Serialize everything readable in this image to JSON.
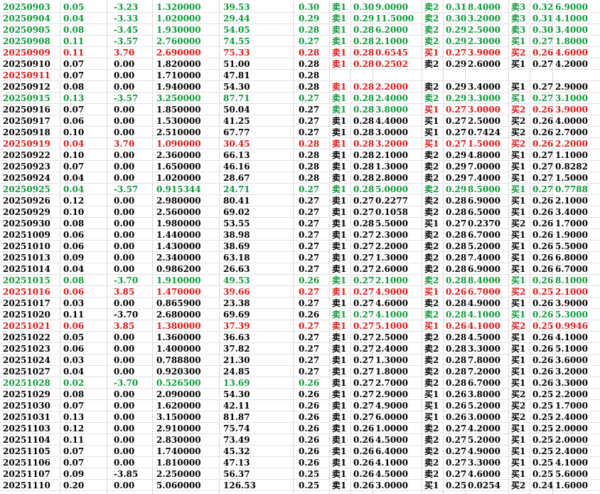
{
  "colors": {
    "up": "#e31414",
    "down": "#0a9a38",
    "flat": "#000000"
  },
  "rows": [
    {
      "date": "20250903",
      "a": "0.05",
      "b": "-3.23",
      "c": "1.320000",
      "d": "39.53",
      "e": "0.30",
      "t1": "卖1",
      "p1": "0.30",
      "v1": "9.0000",
      "t2": "卖2",
      "p2": "0.31",
      "v2": "8.4000",
      "t3": "卖3",
      "p3": "0.32",
      "v3": "6.9000",
      "color": "green",
      "c1": "green",
      "c2": "green",
      "c3": "green"
    },
    {
      "date": "20250904",
      "a": "0.04",
      "b": "-3.33",
      "c": "1.020000",
      "d": "29.44",
      "e": "0.29",
      "t1": "卖1",
      "p1": "0.29",
      "v1": "11.5000",
      "t2": "卖2",
      "p2": "0.30",
      "v2": "3.2000",
      "t3": "卖3",
      "p3": "0.31",
      "v3": "4.1000",
      "color": "green",
      "c1": "green",
      "c2": "green",
      "c3": "green"
    },
    {
      "date": "20250905",
      "a": "0.08",
      "b": "-3.45",
      "c": "1.930000",
      "d": "54.05",
      "e": "0.28",
      "t1": "卖1",
      "p1": "0.28",
      "v1": "6.2000",
      "t2": "卖2",
      "p2": "0.29",
      "v2": "2.5000",
      "t3": "卖3",
      "p3": "0.30",
      "v3": "3.4000",
      "color": "green",
      "c1": "green",
      "c2": "green",
      "c3": "green"
    },
    {
      "date": "20250908",
      "a": "0.11",
      "b": "-3.57",
      "c": "2.760000",
      "d": "74.55",
      "e": "0.27",
      "t1": "卖1",
      "p1": "0.28",
      "v1": "2.1000",
      "t2": "卖2",
      "p2": "0.29",
      "v2": "2.3000",
      "t3": "买1",
      "p3": "0.27",
      "v3": "1.8000",
      "color": "green",
      "c1": "green",
      "c2": "green",
      "c3": "green"
    },
    {
      "date": "20250909",
      "a": "0.11",
      "b": "3.70",
      "c": "2.690000",
      "d": "75.33",
      "e": "0.28",
      "t1": "卖1",
      "p1": "0.28",
      "v1": "0.6545",
      "t2": "买1",
      "p2": "0.27",
      "v2": "3.9000",
      "t3": "买2",
      "p3": "0.26",
      "v3": "4.6000",
      "color": "red",
      "c1": "red",
      "c2": "red",
      "c3": "red"
    },
    {
      "date": "20250910",
      "a": "0.07",
      "b": "0.00",
      "c": "1.820000",
      "d": "51.00",
      "e": "0.28",
      "t1": "卖1",
      "p1": "0.28",
      "v1": "0.2502",
      "t2": "卖2",
      "p2": "0.29",
      "v2": "2.6000",
      "t3": "买1",
      "p3": "0.27",
      "v3": "4.2000",
      "color": "black",
      "c1": "red",
      "c2": "black",
      "c3": "black"
    },
    {
      "date": "20250911",
      "a": "0.07",
      "b": "0.00",
      "c": "1.710000",
      "d": "47.81",
      "e": "0.28",
      "t1": "",
      "p1": "",
      "v1": "",
      "t2": "",
      "p2": "",
      "v2": "",
      "t3": "",
      "p3": "",
      "v3": "",
      "color": "black",
      "datecolor": "red",
      "c1": "black",
      "c2": "black",
      "c3": "black"
    },
    {
      "date": "20250912",
      "a": "0.08",
      "b": "0.00",
      "c": "1.940000",
      "d": "54.30",
      "e": "0.28",
      "t1": "卖1",
      "p1": "0.28",
      "v1": "2.2000",
      "t2": "卖2",
      "p2": "0.29",
      "v2": "3.4000",
      "t3": "买1",
      "p3": "0.27",
      "v3": "2.9000",
      "color": "black",
      "c1": "red",
      "c2": "black",
      "c3": "black"
    },
    {
      "date": "20250915",
      "a": "0.13",
      "b": "-3.57",
      "c": "3.250000",
      "d": "87.71",
      "e": "0.27",
      "t1": "卖1",
      "p1": "0.28",
      "v1": "2.4000",
      "t2": "卖2",
      "p2": "0.29",
      "v2": "3.3000",
      "t3": "买1",
      "p3": "0.27",
      "v3": "3.1000",
      "color": "green",
      "c1": "green",
      "c2": "green",
      "c3": "green"
    },
    {
      "date": "20250916",
      "a": "0.07",
      "b": "0.00",
      "c": "1.850000",
      "d": "50.04",
      "e": "0.27",
      "t1": "卖1",
      "p1": "0.28",
      "v1": "3.8000",
      "t2": "买1",
      "p2": "0.27",
      "v2": "3.0000",
      "t3": "买2",
      "p3": "0.26",
      "v3": "3.9000",
      "color": "black",
      "c1": "green",
      "c2": "red",
      "c3": "red"
    },
    {
      "date": "20250917",
      "a": "0.06",
      "b": "0.00",
      "c": "1.530000",
      "d": "41.25",
      "e": "0.27",
      "t1": "卖1",
      "p1": "0.28",
      "v1": "4.4000",
      "t2": "买1",
      "p2": "0.27",
      "v2": "2.5000",
      "t3": "买2",
      "p3": "0.26",
      "v3": "4.0000",
      "color": "black",
      "c1": "black",
      "c2": "black",
      "c3": "black"
    },
    {
      "date": "20250918",
      "a": "0.10",
      "b": "0.00",
      "c": "2.510000",
      "d": "67.77",
      "e": "0.27",
      "t1": "卖1",
      "p1": "0.28",
      "v1": "3.0000",
      "t2": "买1",
      "p2": "0.27",
      "v2": "0.7424",
      "t3": "买2",
      "p3": "0.26",
      "v3": "2.7000",
      "color": "black",
      "c1": "black",
      "c2": "black",
      "c3": "black"
    },
    {
      "date": "20250919",
      "a": "0.04",
      "b": "3.70",
      "c": "1.090000",
      "d": "30.45",
      "e": "0.28",
      "t1": "卖1",
      "p1": "0.28",
      "v1": "3.2000",
      "t2": "买1",
      "p2": "0.27",
      "v2": "1.5000",
      "t3": "买2",
      "p3": "0.26",
      "v3": "2.2000",
      "color": "red",
      "c1": "red",
      "c2": "red",
      "c3": "red"
    },
    {
      "date": "20250922",
      "a": "0.10",
      "b": "0.00",
      "c": "2.360000",
      "d": "66.13",
      "e": "0.28",
      "t1": "卖1",
      "p1": "0.28",
      "v1": "2.1000",
      "t2": "卖2",
      "p2": "0.29",
      "v2": "4.8000",
      "t3": "买1",
      "p3": "0.27",
      "v3": "1.1000",
      "color": "black",
      "c1": "black",
      "c2": "black",
      "c3": "black"
    },
    {
      "date": "20250923",
      "a": "0.07",
      "b": "0.00",
      "c": "1.650000",
      "d": "46.16",
      "e": "0.28",
      "t1": "卖1",
      "p1": "0.28",
      "v1": "1.3000",
      "t2": "卖2",
      "p2": "0.29",
      "v2": "7.0000",
      "t3": "买1",
      "p3": "0.27",
      "v3": "0.8282",
      "color": "black",
      "c1": "black",
      "c2": "black",
      "c3": "black"
    },
    {
      "date": "20250924",
      "a": "0.04",
      "b": "0.00",
      "c": "1.020000",
      "d": "28.67",
      "e": "0.28",
      "t1": "卖1",
      "p1": "0.28",
      "v1": "2.8000",
      "t2": "卖2",
      "p2": "0.29",
      "v2": "7.4000",
      "t3": "买1",
      "p3": "0.27",
      "v3": "1.5000",
      "color": "black",
      "c1": "black",
      "c2": "black",
      "c3": "black"
    },
    {
      "date": "20250925",
      "a": "0.04",
      "b": "-3.57",
      "c": "0.915344",
      "d": "24.71",
      "e": "0.27",
      "t1": "卖1",
      "p1": "0.28",
      "v1": "5.0000",
      "t2": "卖2",
      "p2": "0.29",
      "v2": "8.5000",
      "t3": "买1",
      "p3": "0.27",
      "v3": "0.7788",
      "color": "green",
      "c1": "green",
      "c2": "green",
      "c3": "green"
    },
    {
      "date": "20250926",
      "a": "0.12",
      "b": "0.00",
      "c": "2.980000",
      "d": "80.41",
      "e": "0.27",
      "t1": "卖1",
      "p1": "0.27",
      "v1": "0.2277",
      "t2": "卖2",
      "p2": "0.28",
      "v2": "6.9000",
      "t3": "买1",
      "p3": "0.26",
      "v3": "2.1000",
      "color": "black",
      "c1": "black",
      "c2": "black",
      "c3": "black"
    },
    {
      "date": "20250929",
      "a": "0.10",
      "b": "0.00",
      "c": "2.560000",
      "d": "69.02",
      "e": "0.27",
      "t1": "卖1",
      "p1": "0.27",
      "v1": "0.1058",
      "t2": "卖2",
      "p2": "0.28",
      "v2": "6.5000",
      "t3": "买1",
      "p3": "0.26",
      "v3": "3.4000",
      "color": "black",
      "c1": "black",
      "c2": "black",
      "c3": "black"
    },
    {
      "date": "20250930",
      "a": "0.08",
      "b": "0.00",
      "c": "1.980000",
      "d": "53.55",
      "e": "0.27",
      "t1": "卖1",
      "p1": "0.28",
      "v1": "5.5000",
      "t2": "买1",
      "p2": "0.27",
      "v2": "0.2370",
      "t3": "买2",
      "p3": "0.26",
      "v3": "1.7000",
      "color": "black",
      "c1": "black",
      "c2": "black",
      "c3": "black"
    },
    {
      "date": "20251009",
      "a": "0.06",
      "b": "0.00",
      "c": "1.440000",
      "d": "38.98",
      "e": "0.27",
      "t1": "卖1",
      "p1": "0.27",
      "v1": "2.3000",
      "t2": "卖2",
      "p2": "0.28",
      "v2": "6.7000",
      "t3": "买1",
      "p3": "0.26",
      "v3": "1.9000",
      "color": "black",
      "c1": "black",
      "c2": "black",
      "c3": "black"
    },
    {
      "date": "20251010",
      "a": "0.06",
      "b": "0.00",
      "c": "1.430000",
      "d": "38.69",
      "e": "0.27",
      "t1": "卖1",
      "p1": "0.27",
      "v1": "2.2000",
      "t2": "卖2",
      "p2": "0.28",
      "v2": "5.2000",
      "t3": "买1",
      "p3": "0.26",
      "v3": "5.5000",
      "color": "black",
      "c1": "black",
      "c2": "black",
      "c3": "black"
    },
    {
      "date": "20251013",
      "a": "0.09",
      "b": "0.00",
      "c": "2.340000",
      "d": "63.18",
      "e": "0.27",
      "t1": "卖1",
      "p1": "0.27",
      "v1": "1.3000",
      "t2": "卖2",
      "p2": "0.28",
      "v2": "7.4000",
      "t3": "买1",
      "p3": "0.26",
      "v3": "6.8000",
      "color": "black",
      "c1": "black",
      "c2": "black",
      "c3": "black"
    },
    {
      "date": "20251014",
      "a": "0.04",
      "b": "0.00",
      "c": "0.986200",
      "d": "26.63",
      "e": "0.27",
      "t1": "卖1",
      "p1": "0.27",
      "v1": "2.6000",
      "t2": "卖2",
      "p2": "0.28",
      "v2": "6.9000",
      "t3": "买1",
      "p3": "0.26",
      "v3": "6.7000",
      "color": "black",
      "c1": "black",
      "c2": "black",
      "c3": "black"
    },
    {
      "date": "20251015",
      "a": "0.08",
      "b": "-3.70",
      "c": "1.910000",
      "d": "49.53",
      "e": "0.26",
      "t1": "卖1",
      "p1": "0.27",
      "v1": "2.1000",
      "t2": "卖2",
      "p2": "0.28",
      "v2": "8.4000",
      "t3": "买1",
      "p3": "0.26",
      "v3": "8.1000",
      "color": "green",
      "c1": "green",
      "c2": "green",
      "c3": "green"
    },
    {
      "date": "20251016",
      "a": "0.06",
      "b": "3.85",
      "c": "1.470000",
      "d": "39.66",
      "e": "0.27",
      "t1": "卖1",
      "p1": "0.27",
      "v1": "4.9000",
      "t2": "买1",
      "p2": "0.26",
      "v2": "6.7000",
      "t3": "买2",
      "p3": "0.25",
      "v3": "2.1000",
      "color": "red",
      "c1": "red",
      "c2": "red",
      "c3": "red"
    },
    {
      "date": "20251017",
      "a": "0.03",
      "b": "0.00",
      "c": "0.865900",
      "d": "23.38",
      "e": "0.27",
      "t1": "卖1",
      "p1": "0.27",
      "v1": "4.6000",
      "t2": "卖2",
      "p2": "0.28",
      "v2": "4.9000",
      "t3": "买1",
      "p3": "0.26",
      "v3": "3.9000",
      "color": "black",
      "c1": "black",
      "c2": "black",
      "c3": "black"
    },
    {
      "date": "20251020",
      "a": "0.11",
      "b": "-3.70",
      "c": "2.680000",
      "d": "69.69",
      "e": "0.26",
      "t1": "卖1",
      "p1": "0.27",
      "v1": "4.1000",
      "t2": "卖2",
      "p2": "0.28",
      "v2": "4.1000",
      "t3": "买1",
      "p3": "0.26",
      "v3": "5.3000",
      "color": "black",
      "c1": "green",
      "c2": "green",
      "c3": "green"
    },
    {
      "date": "20251021",
      "a": "0.06",
      "b": "3.85",
      "c": "1.380000",
      "d": "37.39",
      "e": "0.27",
      "t1": "卖1",
      "p1": "0.27",
      "v1": "5.1000",
      "t2": "买1",
      "p2": "0.26",
      "v2": "4.1000",
      "t3": "买2",
      "p3": "0.25",
      "v3": "0.9946",
      "color": "red",
      "c1": "red",
      "c2": "red",
      "c3": "red"
    },
    {
      "date": "20251022",
      "a": "0.05",
      "b": "0.00",
      "c": "1.360000",
      "d": "36.63",
      "e": "0.27",
      "t1": "卖1",
      "p1": "0.27",
      "v1": "2.5000",
      "t2": "卖2",
      "p2": "0.28",
      "v2": "4.5000",
      "t3": "买1",
      "p3": "0.26",
      "v3": "4.1000",
      "color": "black",
      "c1": "black",
      "c2": "black",
      "c3": "black"
    },
    {
      "date": "20251023",
      "a": "0.06",
      "b": "0.00",
      "c": "1.400000",
      "d": "37.82",
      "e": "0.27",
      "t1": "卖1",
      "p1": "0.27",
      "v1": "2.4000",
      "t2": "卖2",
      "p2": "0.28",
      "v2": "3.3000",
      "t3": "买1",
      "p3": "0.26",
      "v3": "5.1000",
      "color": "black",
      "c1": "black",
      "c2": "black",
      "c3": "black"
    },
    {
      "date": "20251024",
      "a": "0.03",
      "b": "0.00",
      "c": "0.788800",
      "d": "21.30",
      "e": "0.27",
      "t1": "卖1",
      "p1": "0.27",
      "v1": "1.3000",
      "t2": "卖2",
      "p2": "0.28",
      "v2": "7.8000",
      "t3": "买1",
      "p3": "0.26",
      "v3": "3.6000",
      "color": "black",
      "c1": "black",
      "c2": "black",
      "c3": "black"
    },
    {
      "date": "20251027",
      "a": "0.04",
      "b": "0.00",
      "c": "0.920300",
      "d": "24.85",
      "e": "0.27",
      "t1": "卖1",
      "p1": "0.27",
      "v1": "1.8000",
      "t2": "卖2",
      "p2": "0.28",
      "v2": "7.2000",
      "t3": "买1",
      "p3": "0.26",
      "v3": "3.2000",
      "color": "black",
      "c1": "black",
      "c2": "black",
      "c3": "black"
    },
    {
      "date": "20251028",
      "a": "0.02",
      "b": "-3.70",
      "c": "0.526500",
      "d": "13.69",
      "e": "0.26",
      "t1": "卖1",
      "p1": "0.27",
      "v1": "2.7000",
      "t2": "卖2",
      "p2": "0.28",
      "v2": "6.7000",
      "t3": "买1",
      "p3": "0.26",
      "v3": "3.3000",
      "color": "green",
      "c1": "black",
      "c2": "black",
      "c3": "black"
    },
    {
      "date": "20251029",
      "a": "0.08",
      "b": "0.00",
      "c": "2.090000",
      "d": "54.30",
      "e": "0.26",
      "t1": "卖1",
      "p1": "0.27",
      "v1": "2.9000",
      "t2": "买1",
      "p2": "0.26",
      "v2": "3.8000",
      "t3": "买2",
      "p3": "0.25",
      "v3": "2.2000",
      "color": "black",
      "c1": "black",
      "c2": "black",
      "c3": "black"
    },
    {
      "date": "20251030",
      "a": "0.07",
      "b": "0.00",
      "c": "1.620000",
      "d": "42.11",
      "e": "0.26",
      "t1": "卖1",
      "p1": "0.27",
      "v1": "4.9000",
      "t2": "买1",
      "p2": "0.26",
      "v2": "5.2000",
      "t3": "买2",
      "p3": "0.25",
      "v3": "1.7000",
      "color": "black",
      "c1": "black",
      "c2": "black",
      "c3": "black"
    },
    {
      "date": "20251031",
      "a": "0.13",
      "b": "0.00",
      "c": "3.150000",
      "d": "81.87",
      "e": "0.26",
      "t1": "卖1",
      "p1": "0.27",
      "v1": "6.0000",
      "t2": "买1",
      "p2": "0.26",
      "v2": "3.0000",
      "t3": "买2",
      "p3": "0.25",
      "v3": "2.4000",
      "color": "black",
      "c1": "black",
      "c2": "black",
      "c3": "black"
    },
    {
      "date": "20251103",
      "a": "0.12",
      "b": "0.00",
      "c": "2.910000",
      "d": "75.74",
      "e": "0.26",
      "t1": "卖1",
      "p1": "0.26",
      "v1": "1.0000",
      "t2": "卖2",
      "p2": "0.27",
      "v2": "4.2000",
      "t3": "买1",
      "p3": "0.25",
      "v3": "2.0000",
      "color": "black",
      "c1": "black",
      "c2": "black",
      "c3": "black"
    },
    {
      "date": "20251104",
      "a": "0.11",
      "b": "0.00",
      "c": "2.830000",
      "d": "73.49",
      "e": "0.26",
      "t1": "卖1",
      "p1": "0.26",
      "v1": "4.5000",
      "t2": "卖2",
      "p2": "0.27",
      "v2": "5.2000",
      "t3": "买1",
      "p3": "0.25",
      "v3": "2.0000",
      "color": "black",
      "c1": "black",
      "c2": "black",
      "c3": "black"
    },
    {
      "date": "20251105",
      "a": "0.07",
      "b": "0.00",
      "c": "1.740000",
      "d": "45.32",
      "e": "0.26",
      "t1": "卖1",
      "p1": "0.26",
      "v1": "6.4000",
      "t2": "卖2",
      "p2": "0.27",
      "v2": "4.9000",
      "t3": "买1",
      "p3": "0.25",
      "v3": "2.4000",
      "color": "black",
      "c1": "black",
      "c2": "black",
      "c3": "black"
    },
    {
      "date": "20251106",
      "a": "0.07",
      "b": "0.00",
      "c": "1.810000",
      "d": "47.13",
      "e": "0.26",
      "t1": "卖1",
      "p1": "0.26",
      "v1": "4.1000",
      "t2": "卖2",
      "p2": "0.27",
      "v2": "3.3000",
      "t3": "买1",
      "p3": "0.25",
      "v3": "4.1000",
      "color": "black",
      "c1": "black",
      "c2": "black",
      "c3": "black"
    },
    {
      "date": "20251107",
      "a": "0.09",
      "b": "-3.85",
      "c": "2.250000",
      "d": "56.37",
      "e": "0.25",
      "t1": "卖1",
      "p1": "0.26",
      "v1": "4.5000",
      "t2": "卖2",
      "p2": "0.27",
      "v2": "4.6000",
      "t3": "买1",
      "p3": "0.25",
      "v3": "5.6000",
      "color": "black",
      "c1": "black",
      "c2": "black",
      "c3": "black"
    },
    {
      "date": "20251110",
      "a": "0.20",
      "b": "0.00",
      "c": "5.060000",
      "d": "126.53",
      "e": "0.25",
      "t1": "卖1",
      "p1": "0.26",
      "v1": "3.0000",
      "t2": "买1",
      "p2": "0.25",
      "v2": "0.0254",
      "t3": "买2",
      "p3": "0.24",
      "v3": "1.6000",
      "color": "black",
      "c1": "black",
      "c2": "black",
      "c3": "black"
    }
  ]
}
